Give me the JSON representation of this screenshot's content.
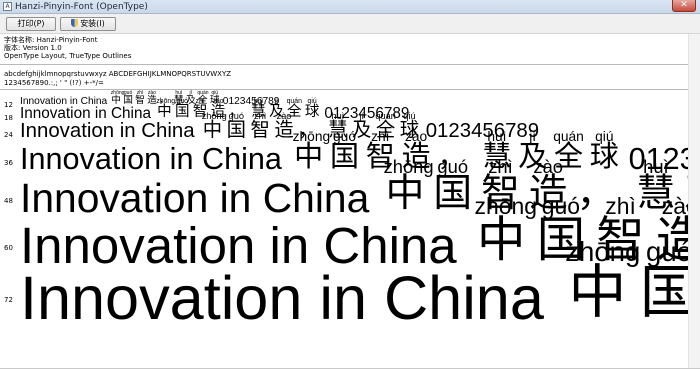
{
  "window": {
    "title": "Hanzi-Pinyin-Font (OpenType)",
    "close_label": "✕"
  },
  "toolbar": {
    "print_label": "打印(P)",
    "install_label": "安装(I)"
  },
  "info": {
    "font_name": "字体名称: Hanzi-Pinyin-Font",
    "version": "版本: Version 1.0",
    "features": "OpenType Layout, TrueType Outlines"
  },
  "charset": {
    "letters": "abcdefghijklmnopqrstuvwxyz ABCDEFGHIJKLMNOPQRSTUVWXYZ",
    "digits": "1234567890.:,; ' \" (!?) +-*/="
  },
  "sample": {
    "english": "Innovation in China",
    "chars": [
      {
        "ch": "中",
        "py": "zhōng"
      },
      {
        "ch": "国",
        "py": "guó"
      },
      {
        "ch": "智",
        "py": "zhì"
      },
      {
        "ch": "造",
        "py": "zào"
      },
      {
        "ch": "，",
        "py": ""
      },
      {
        "ch": "慧",
        "py": "huì"
      },
      {
        "ch": "及",
        "py": "jí"
      },
      {
        "ch": "全",
        "py": "quán"
      },
      {
        "ch": "球",
        "py": "qiú"
      }
    ],
    "digits": "0123456789"
  },
  "sizes": [
    {
      "label": "12",
      "value": 12
    },
    {
      "label": "18",
      "value": 18
    },
    {
      "label": "24",
      "value": 24
    },
    {
      "label": "36",
      "value": 36
    },
    {
      "label": "48",
      "value": 48
    },
    {
      "label": "60",
      "value": 60
    },
    {
      "label": "72",
      "value": 72
    }
  ]
}
